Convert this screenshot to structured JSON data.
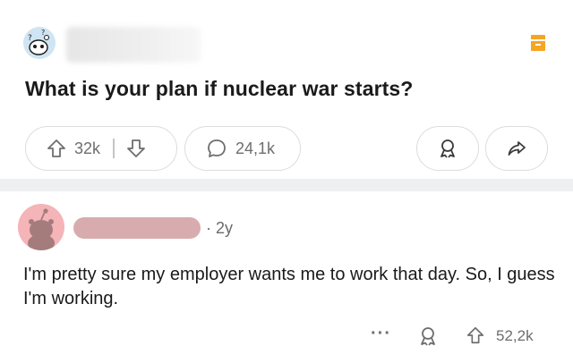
{
  "post": {
    "title": "What is your plan if nuclear war starts?",
    "upvotes": "32k",
    "comments": "24,1k"
  },
  "comment": {
    "age": "· 2y",
    "body": "I'm pretty sure my employer wants me to work that day. So, I guess I'm working.",
    "more": "···",
    "score": "52,2k"
  },
  "icons": {
    "subreddit_avatar": "snoo-avatar-icon",
    "bookmark": "bookmark-icon",
    "upvote": "upvote-arrow-icon",
    "downvote": "downvote-arrow-icon",
    "comment": "comment-bubble-icon",
    "award": "award-icon",
    "share": "share-arrow-icon",
    "user_avatar": "user-avatar-icon"
  },
  "colors": {
    "bookmark": "#f5a623",
    "user_avatar_bg": "#f4b4b8"
  }
}
